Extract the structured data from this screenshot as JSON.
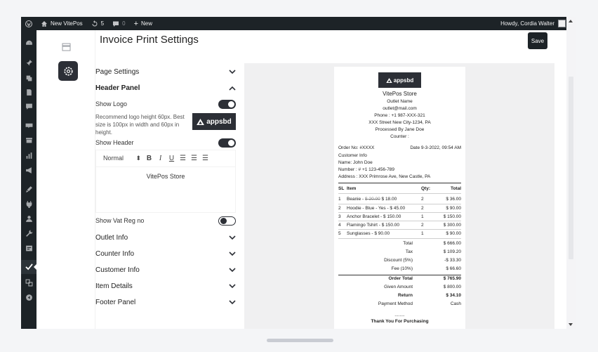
{
  "adminbar": {
    "site_name": "New VitePos",
    "updates_count": "5",
    "comments_count": "0",
    "new_label": "New",
    "howdy": "Howdy, Cordia Walter"
  },
  "page": {
    "title": "Invoice Print Settings",
    "save_label": "Save"
  },
  "sidemenu": {
    "icons": [
      "dashboard-icon",
      "pin-icon",
      "media-icon",
      "pages-icon",
      "comments-icon",
      "woocommerce-icon",
      "products-icon",
      "analytics-icon",
      "marketing-icon",
      "appearance-icon",
      "plugins-icon",
      "users-icon",
      "tools-icon",
      "settings-icon",
      "vitepos-icon",
      "translate-icon",
      "collapse-icon"
    ]
  },
  "settings": {
    "page_settings": "Page Settings",
    "header_panel": "Header Panel",
    "show_logo": "Show Logo",
    "logo_hint": "Recommend logo height 60px. Best size is 100px in width and 60px in height.",
    "logo_text": "appsbd",
    "show_header": "Show Header",
    "editor_format": "Normal",
    "editor_content": "VitePos Store",
    "show_vat": "Show Vat Reg no",
    "outlet_info": "Outlet Info",
    "counter_info": "Counter Info",
    "customer_info": "Customer Info",
    "item_details": "Item Details",
    "footer_panel": "Footer Panel",
    "toggles": {
      "show_logo": true,
      "show_header": true,
      "show_vat": false
    }
  },
  "receipt": {
    "logo_text": "appsbd",
    "store_name": "VitePos Store",
    "outlet_name": "Outlet Name",
    "email": "outlet@mail.com",
    "phone": "Phone : +1 987-XXX-321",
    "address": "XXX Street New City-1234, PA",
    "processed_by": "Processed By Jane Doe",
    "counter": "Counter :",
    "order_no": "Order No: #XXXX",
    "date": "Date 9-3-2022, 09:54 AM",
    "customer_info": "Customer Info",
    "customer_name": "Name: John Doe",
    "customer_number": "Number : # +1 123-456-789",
    "customer_address": "Address : XXX Primrose Ave, New Castle, PA",
    "headers": {
      "sl": "SL",
      "item": "Item",
      "qty": "Qty:",
      "total": "Total"
    },
    "items": [
      {
        "sl": "1",
        "name": "Beanie - ",
        "old": "$ 20.00",
        "price": " $ 18.00",
        "qty": "2",
        "total": "$ 36.00"
      },
      {
        "sl": "2",
        "name": "Hoodie - Blue - Yes - $ 45.00",
        "old": "",
        "price": "",
        "qty": "2",
        "total": "$ 90.00"
      },
      {
        "sl": "3",
        "name": "Anchor Bracelet - $ 150.00",
        "old": "",
        "price": "",
        "qty": "1",
        "total": "$ 150.00"
      },
      {
        "sl": "4",
        "name": "Flamingo Tshirt - $ 150.00",
        "old": "",
        "price": "",
        "qty": "2",
        "total": "$ 300.00"
      },
      {
        "sl": "5",
        "name": "Sunglasses - $ 90.00",
        "old": "",
        "price": "",
        "qty": "1",
        "total": "$ 90.00"
      }
    ],
    "totals": [
      {
        "label": "Total",
        "value": "$ 666.00",
        "bold": false
      },
      {
        "label": "Tax",
        "value": "$ 109.20",
        "bold": false
      },
      {
        "label": "Discount (5%)",
        "value": "-$ 33.30",
        "bold": false
      },
      {
        "label": "Fee (10%)",
        "value": "$ 66.60",
        "bold": false
      }
    ],
    "order_total": {
      "label": "Order Total",
      "value": "$ 765.90"
    },
    "given_amount": {
      "label": "Given Amount",
      "value": "$ 800.00"
    },
    "return": {
      "label": "Return",
      "value": "$ 34.10"
    },
    "payment_method": {
      "label": "Payment Method",
      "value": "Cash"
    },
    "dots": "........",
    "thank_you": "Thank You For Purchasing"
  }
}
